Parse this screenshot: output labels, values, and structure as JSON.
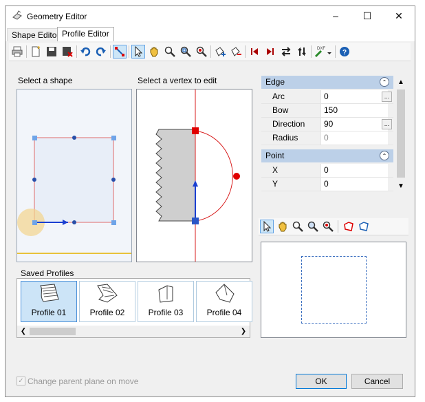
{
  "window": {
    "title": "Geometry Editor",
    "title_icon": "geometry-editor-icon"
  },
  "tabs": [
    {
      "label": "Shape Editor"
    },
    {
      "label": "Profile Editor"
    }
  ],
  "toolbar": {
    "icons": [
      "print-icon",
      "new-icon",
      "save-icon",
      "delete-icon",
      "undo-icon",
      "redo-icon",
      "edit-vertex-icon",
      "select-arrow-icon",
      "pan-hand-icon",
      "zoom-icon",
      "zoom-window-icon",
      "zoom-extents-icon",
      "add-vertex-icon",
      "remove-vertex-icon",
      "first-icon",
      "last-icon",
      "reverse-icon",
      "flip-icon",
      "dxf-import-icon",
      "help-icon"
    ],
    "dxf_label": "DXF"
  },
  "shape_panel": {
    "label": "Select a shape"
  },
  "vertex_panel": {
    "label": "Select a vertex to edit"
  },
  "properties": {
    "edge": {
      "title": "Edge",
      "rows": [
        {
          "name": "Arc",
          "value": "0",
          "has_button": true
        },
        {
          "name": "Bow",
          "value": "150"
        },
        {
          "name": "Direction",
          "value": "90",
          "has_button": true
        },
        {
          "name": "Radius",
          "value": "0",
          "disabled": true
        }
      ]
    },
    "point": {
      "title": "Point",
      "rows": [
        {
          "name": "X",
          "value": "0"
        },
        {
          "name": "Y",
          "value": "0"
        }
      ]
    },
    "button_label": "..."
  },
  "saved_profiles": {
    "label": "Saved Profiles",
    "items": [
      {
        "name": "Profile 01",
        "selected": true
      },
      {
        "name": "Profile 02"
      },
      {
        "name": "Profile 03"
      },
      {
        "name": "Profile 04"
      }
    ]
  },
  "preview_toolbar": {
    "icons": [
      "select-arrow-icon",
      "pan-hand-icon",
      "zoom-icon",
      "zoom-window-icon",
      "zoom-extents-icon",
      "shape-red-icon",
      "shape-blue-icon"
    ]
  },
  "footer": {
    "checkbox_label": "Change parent plane on move",
    "checkbox_checked": true,
    "ok": "OK",
    "cancel": "Cancel"
  },
  "colors": {
    "accent": "#0078d7",
    "header_bg": "#bcd0e8",
    "red": "#e00000",
    "blue": "#1a3fd1"
  }
}
